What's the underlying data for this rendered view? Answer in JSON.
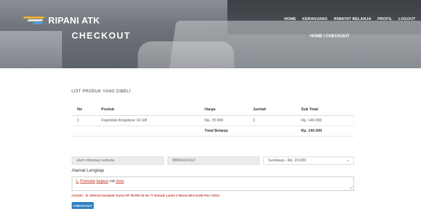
{
  "header": {
    "brand": "RIPANI ATK",
    "nav": [
      "HOME",
      "KERANJANG",
      "RIWAYAT BELANJA",
      "PROFIL",
      "LOGOUT"
    ],
    "page_title": "CHECKOUT",
    "breadcrumb": "HOME / CHECKOUT"
  },
  "cart": {
    "section_title": "LIST PRODUK YANG DIBELI",
    "columns": [
      "No",
      "Produk",
      "Harga",
      "Jumlah",
      "Sub Total"
    ],
    "rows": [
      {
        "no": "1",
        "produk": "Flashdisk Kingstone 16 GB",
        "harga": "Rp. 70.000",
        "jumlah": "2",
        "subtotal": "Rp. 140.000"
      }
    ],
    "total_label": "Total Belanja",
    "total_value": "Rp. 140.000"
  },
  "form": {
    "name_value": "ulum nihomas sulmula",
    "phone_value": "08966432110",
    "city_selected": "Surabaya - Rp. 20.000",
    "address_label": "Alamat Lengkap",
    "address_prefix": "1.",
    "address_words": [
      "Pramatia",
      "lanjaun"
    ],
    "address_mid": "vat",
    "address_end": "mula",
    "hint": "Contoh : Jl. Veteran Komplek Gunto RT 08 RW 02 No 77 Rumah Lantai 2 Warna Biru Kode Pos 72212",
    "submit_label": "CHECKOUT"
  }
}
